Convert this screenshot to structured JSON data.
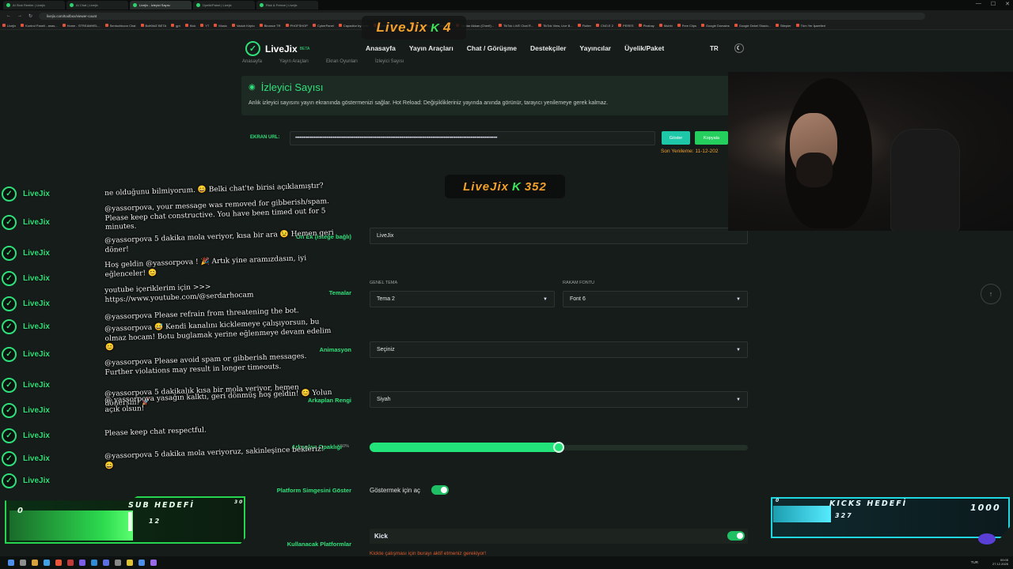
{
  "browser": {
    "tabs": [
      "AI Stok Reeller | Livejix",
      "AI Chat | Livejix",
      "Livejix - İzleyici Sayısı",
      "Üyelik/Paket | Livejix",
      "Risk & Freeze | Livejix"
    ],
    "url": "livejix.com/toolbox/viewer-count",
    "bookmarks": [
      "Livejix",
      "Kontrol Paneli - anas...",
      "Home - STREAMHEL...",
      "Sentuchkoon Chat",
      "BotKit#Z BETA",
      "gpt",
      "Kick",
      "YT",
      "Music",
      "Vaduh Kripto",
      "Binance TR",
      "PHOFSHOP",
      "CyberPanel",
      "Capacitor by ionic",
      "Connect, Embed an...",
      "Squarespace Domain...",
      "Serdar Akkan (Cherif)...",
      "TikTok LIVE Chat R...",
      "TikTok View, Live B...",
      "Flutter",
      "CNO.E 2",
      "PERES",
      "Pixabay",
      "Mobbi",
      "Free Clips",
      "Google Domains",
      "Google Dekel Shado...",
      "Sitepier",
      "Tüm Yer İşaretleri"
    ]
  },
  "overlay": {
    "top_badge_text": "LiveJix",
    "top_badge_count": "4",
    "mid_badge_text": "LiveJix",
    "mid_badge_count": "352"
  },
  "nav": {
    "brand": "LiveJix",
    "beta": "BETA",
    "menu": [
      "Anasayfa",
      "Yayın Araçları",
      "Chat / Görüşme",
      "Destekçiler",
      "Yayıncılar",
      "Üyelik/Paket"
    ],
    "lang": "TR",
    "theme_icon": "☾"
  },
  "breadcrumbs": [
    "Anasayfa",
    "Yayın Araçları",
    "Ekran Oyunları",
    "İzleyici Sayısı"
  ],
  "page": {
    "title": "İzleyici Sayısı",
    "description": "Anlık izleyici sayısını yayın ekranında göstermenizi sağlar. Hot Reload: Değişiklikleriniz yayında anında görünür, tarayıcı yenilemeye gerek kalmaz.",
    "url_label": "EKRAN URL:",
    "url_value": "••••••••••••••••••••••••••••••••••••••••••••••••••••••••••••••••••••••••••••••••••••••••••••••••••••••••••••••••••••••••••••••••••••••••••••••••••••••",
    "show_button": "Göster",
    "copy_button": "Kopyala",
    "last_refresh": "Son Yenileme: 11-12-202"
  },
  "form": {
    "prefix_label": "Ön Ek (isteğe bağlı)",
    "prefix_value": "LiveJix",
    "themes_label": "Temalar",
    "general_theme_label": "GENEL TEMA",
    "general_theme_value": "Tema 2",
    "number_font_label": "RAKAM FONTU",
    "number_font_value": "Font 6",
    "animation_label": "Animasyon",
    "animation_value": "Seçiniz",
    "background_color_label": "Arkaplan Rengi",
    "background_color_value": "Siyah",
    "opacity_label": "Arkaplan Opaklığı",
    "opacity_value": "50%",
    "opacity_fraction": 0.5,
    "platform_icon_label": "Platform Simgesini Göster",
    "platform_icon_toggle_text": "Göstermek için aç",
    "platforms_label": "Kullanacak Platformlar",
    "platform_kick": "Kick",
    "kick_warning": "Kickte çalışması için burayı aktif etmeniz gerekiyor!"
  },
  "chat": {
    "username": "LiveJix",
    "messages": [
      "ne olduğunu bilmiyorum. 😄 Belki chat'te birisi açıklamıştır?",
      "@yassorpova, your message was removed for gibberish/spam. Please keep chat constructive. You have been timed out for 5 minutes.",
      "@yassorpova 5 dakika mola veriyor, kısa bir ara 😉 Hemen geri döner!",
      "Hoş geldin @yassorpova ! 🎉 Artık yine aramızdasın, iyi eğlenceler! 😊",
      "youtube içeriklerim için >>> https://www.youtube.com/@serdarhocam",
      "@yassorpova Please refrain from threatening the bot.",
      "@yassorpova 😅 Kendi kanalını kicklemeye çalışıyorsun, bu olmaz hocam! Botu buglamak yerine eğlenmeye devam edelim 😊",
      "@yassorpova Please avoid spam or gibberish messages. Further violations may result in longer timeouts.",
      "@yassorpova 5 dakikalık kısa bir mola veriyor, hemen dönersin! 🚀",
      "@ yassorpova yasağın kalktı, geri dönmüş hoş geldin! 😊 Yolun açık olsun!",
      "Please keep chat respectful.",
      "@yassorpova 5 dakika mola veriyoruz, sakinleşince bekleriz! 😄"
    ]
  },
  "sub_goal": {
    "title": "SUB HEDEFİ",
    "current": "0",
    "target": "30",
    "progress_label": "12",
    "progress_fraction": 0.4
  },
  "kicks_goal": {
    "title": "KICKS HEDEFİ",
    "current": "0",
    "target": "1000",
    "progress_label": "327",
    "progress_fraction": 0.33
  },
  "taskbar": {
    "time": "00:05",
    "date": "27.12.2025",
    "lang": "TUR"
  },
  "colors": {
    "accent": "#2fe07a",
    "orange": "#f3a12c",
    "cyan": "#1fd7e0"
  }
}
